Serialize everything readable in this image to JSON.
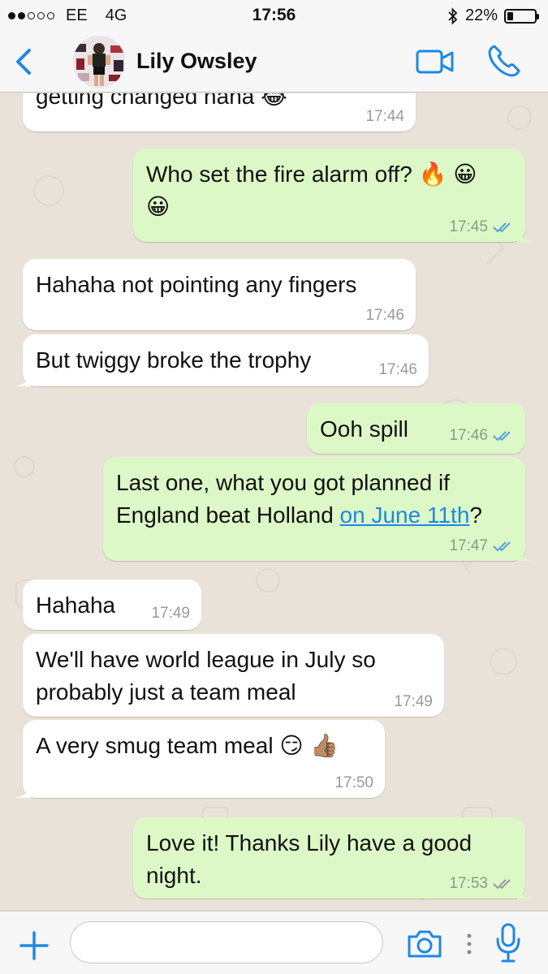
{
  "status_bar": {
    "carrier": "EE",
    "network": "4G",
    "time": "17:56",
    "battery_percent": "22%",
    "battery_level": 0.22,
    "signal_bars_filled": 2,
    "signal_bars_total": 5
  },
  "header": {
    "contact_name": "Lily Owsley"
  },
  "messages": [
    {
      "dir": "in",
      "text": "getting changed haha",
      "emoji": "😂",
      "time": "17:44"
    },
    {
      "dir": "out",
      "text": "Who set the fire alarm off?",
      "emoji": "🔥 😀",
      "emoji2": "😀",
      "time": "17:45",
      "status": "read"
    },
    {
      "dir": "in",
      "text": "Hahaha not pointing any fingers",
      "time": "17:46"
    },
    {
      "dir": "in",
      "text": "But twiggy broke the trophy",
      "time": "17:46"
    },
    {
      "dir": "out",
      "text": "Ooh spill",
      "time": "17:46",
      "status": "read"
    },
    {
      "dir": "out",
      "text_line1": "Last one, what you got planned if",
      "text_line2_before": "England beat Holland ",
      "link": "on June 11th",
      "text_line2_after": "?",
      "time": "17:47",
      "status": "read"
    },
    {
      "dir": "in",
      "text": "Hahaha",
      "time": "17:49"
    },
    {
      "dir": "in",
      "text_line1": "We'll have world league in July so",
      "text_line2": "probably just a team meal",
      "time": "17:49"
    },
    {
      "dir": "in",
      "text": "A very smug team meal",
      "emoji": "😏 👍🏽",
      "time": "17:50"
    },
    {
      "dir": "out",
      "text_line1": "Love it! Thanks Lily have a good",
      "text_line2": "night.",
      "time": "17:53",
      "status": "delivered"
    }
  ],
  "input": {
    "value": "",
    "placeholder": ""
  },
  "colors": {
    "accent_blue": "#1e88e5",
    "outgoing_bubble": "#dcf8c6",
    "incoming_bubble": "#ffffff",
    "read_tick": "#4fa3e0",
    "delivered_tick": "#9a9a9a"
  },
  "icons": {
    "back": "chevron-left-icon",
    "video": "video-camera-icon",
    "phone": "phone-icon",
    "plus": "plus-icon",
    "camera": "camera-icon",
    "mic": "microphone-icon"
  }
}
